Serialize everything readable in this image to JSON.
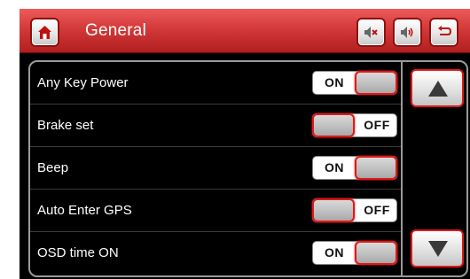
{
  "header": {
    "title": "General",
    "icons": {
      "home": "home-icon",
      "mute": "speaker-mute-icon",
      "volume": "speaker-volume-icon",
      "back": "back-arrow-icon"
    },
    "colors": {
      "header": "#d33a3a",
      "accent": "#e01818"
    }
  },
  "settings": [
    {
      "label": "Any Key Power",
      "state": "ON"
    },
    {
      "label": "Brake set",
      "state": "OFF"
    },
    {
      "label": "Beep",
      "state": "ON"
    },
    {
      "label": "Auto Enter GPS",
      "state": "OFF"
    },
    {
      "label": "OSD time ON",
      "state": "ON"
    }
  ],
  "scroll": {
    "up_icon": "triangle-up-icon",
    "down_icon": "triangle-down-icon"
  }
}
